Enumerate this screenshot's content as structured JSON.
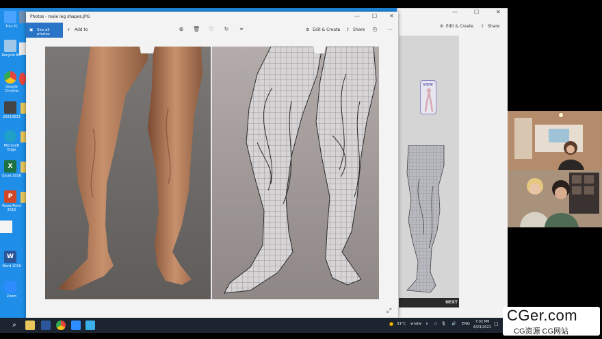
{
  "desktop": {
    "icons": [
      {
        "label": "This PC",
        "color": "#4aa3ff",
        "glyph": ""
      },
      {
        "label": "Recycle Bin",
        "color": "#9fc7e8",
        "glyph": ""
      },
      {
        "label": "Google Chrome",
        "color": "#e8453c",
        "glyph": ""
      },
      {
        "label": "20210623",
        "color": "#444444",
        "glyph": ""
      },
      {
        "label": "Microsoft Edge",
        "color": "#1fa0c8",
        "glyph": ""
      },
      {
        "label": "Excel 2016",
        "color": "#1e7145",
        "glyph": "X"
      },
      {
        "label": "PowerPoint 2016",
        "color": "#d24726",
        "glyph": "P"
      },
      {
        "label": "Word 2016",
        "color": "#2b579a",
        "glyph": "W"
      },
      {
        "label": "Zoom",
        "color": "#2d8cff",
        "glyph": ""
      }
    ]
  },
  "photos_window": {
    "title": "Photos - male leg shapes.JPG",
    "see_all": "See all photos",
    "add_to": "Add to",
    "edit_create": "Edit & Create",
    "share": "Share"
  },
  "back_window": {
    "edit_create": "Edit & Create",
    "share": "Share",
    "view_badge": "VIEW",
    "next": "NEXT"
  },
  "taskbar": {
    "weather": "31°C ",
    "weather_word": "wndw",
    "language": "ENG",
    "time": "7:02 PM",
    "date": "6/23/2021"
  },
  "watermark": {
    "main": "CGer.com",
    "sub": "CG资源 CG网站"
  }
}
